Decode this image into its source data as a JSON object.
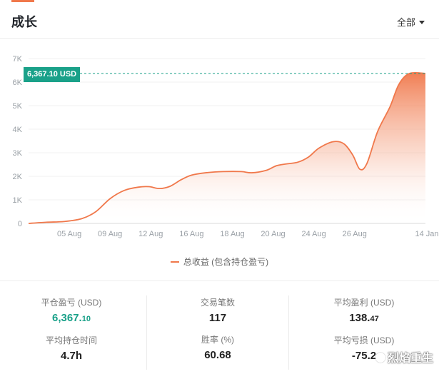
{
  "header": {
    "title": "成长",
    "filter_label": "全部"
  },
  "callout": {
    "text": "6,367.10 USD"
  },
  "legend": {
    "label": "总收益 (包含持仓盈亏)"
  },
  "colors": {
    "accent": "#f0784b",
    "positive": "#1aa189"
  },
  "chart_data": {
    "type": "area",
    "x_ticks": [
      "05 Aug",
      "09 Aug",
      "12 Aug",
      "16 Aug",
      "18 Aug",
      "20 Aug",
      "24 Aug",
      "26 Aug",
      "14 Jan"
    ],
    "y_ticks": [
      "0",
      "1K",
      "2K",
      "3K",
      "4K",
      "5K",
      "6K",
      "7K"
    ],
    "ylim": [
      0,
      7000
    ],
    "series": [
      {
        "name": "总收益 (包含持仓盈亏)",
        "points": [
          [
            0,
            0
          ],
          [
            0.5,
            50
          ],
          [
            1,
            80
          ],
          [
            1.5,
            200
          ],
          [
            1.9,
            500
          ],
          [
            2.3,
            1050
          ],
          [
            2.7,
            1400
          ],
          [
            3.1,
            1540
          ],
          [
            3.4,
            1560
          ],
          [
            3.7,
            1480
          ],
          [
            4.0,
            1580
          ],
          [
            4.3,
            1850
          ],
          [
            4.6,
            2050
          ],
          [
            5.0,
            2150
          ],
          [
            5.5,
            2200
          ],
          [
            6.0,
            2200
          ],
          [
            6.3,
            2150
          ],
          [
            6.7,
            2250
          ],
          [
            7.0,
            2450
          ],
          [
            7.3,
            2530
          ],
          [
            7.6,
            2600
          ],
          [
            7.9,
            2820
          ],
          [
            8.2,
            3200
          ],
          [
            8.6,
            3470
          ],
          [
            8.9,
            3380
          ],
          [
            9.15,
            2900
          ],
          [
            9.35,
            2300
          ],
          [
            9.55,
            2550
          ],
          [
            9.85,
            3900
          ],
          [
            10.2,
            4950
          ],
          [
            10.45,
            5900
          ],
          [
            10.75,
            6367
          ],
          [
            11.2,
            6367
          ]
        ]
      }
    ],
    "x_tick_positions": [
      1,
      2,
      3,
      4,
      5,
      6,
      7,
      8,
      9
    ],
    "annotation": "6,367.10 USD",
    "grid": true,
    "legend_position": "bottom-center"
  },
  "stats": {
    "col1": [
      {
        "label": "平仓盈亏 (USD)",
        "int": "6,367.",
        "dec": "10"
      },
      {
        "label": "平均持仓时间",
        "value": "4.7h"
      }
    ],
    "col2": [
      {
        "label": "交易笔数",
        "value": "117"
      },
      {
        "label": "胜率 (%)",
        "value": "60.68"
      }
    ],
    "col3": [
      {
        "label": "平均盈利 (USD)",
        "int": "138.",
        "dec": "47"
      },
      {
        "label": "平均亏损 (USD)",
        "value": "-75.2"
      }
    ]
  },
  "watermark": {
    "text": "烈焰重生"
  }
}
